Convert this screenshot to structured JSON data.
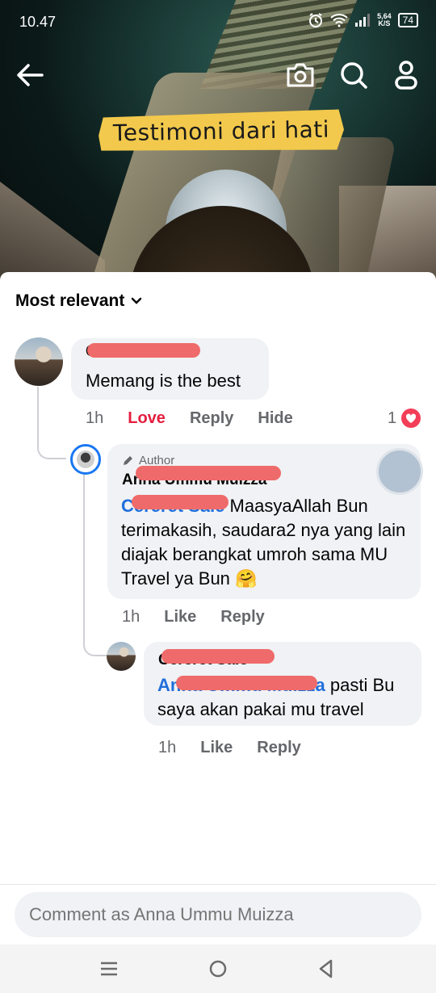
{
  "status": {
    "time": "10.47",
    "net_speed_value": "5,64",
    "net_speed_unit": "K/S",
    "battery": "74"
  },
  "video": {
    "caption": "Testimoni dari hati"
  },
  "sort": {
    "label": "Most relevant"
  },
  "comments": [
    {
      "name": "Cereret Sale",
      "text": "Memang is the best",
      "time": "1h",
      "reaction": "Love",
      "reply": "Reply",
      "hide": "Hide",
      "reaction_count": "1"
    },
    {
      "badge": "Author",
      "name": "Anna Ummu Muizza",
      "mention": "Cereret Sale",
      "text": " MaasyaAllah Bun terimakasih, saudara2 nya yang lain diajak berangkat umroh sama MU Travel ya Bun 🤗",
      "time": "1h",
      "like": "Like",
      "reply": "Reply"
    },
    {
      "name": "Cereret Sale",
      "mention": "Anna Ummu Muizza",
      "text": " pasti Bu saya akan pakai mu travel",
      "time": "1h",
      "like": "Like",
      "reply": "Reply"
    }
  ],
  "composer": {
    "placeholder": "Comment as Anna Ummu Muizza"
  },
  "colors": {
    "accent": "#1877f2",
    "love": "#e41e3f",
    "mention": "#216fdb",
    "redaction": "#ef6a6a",
    "caption_bg": "#f2c94c"
  },
  "icons": [
    "back-arrow-icon",
    "camera-icon",
    "search-icon",
    "profile-icon",
    "chevron-down-icon",
    "pencil-icon",
    "heart-icon",
    "recents-icon",
    "home-icon",
    "back-triangle-icon"
  ]
}
